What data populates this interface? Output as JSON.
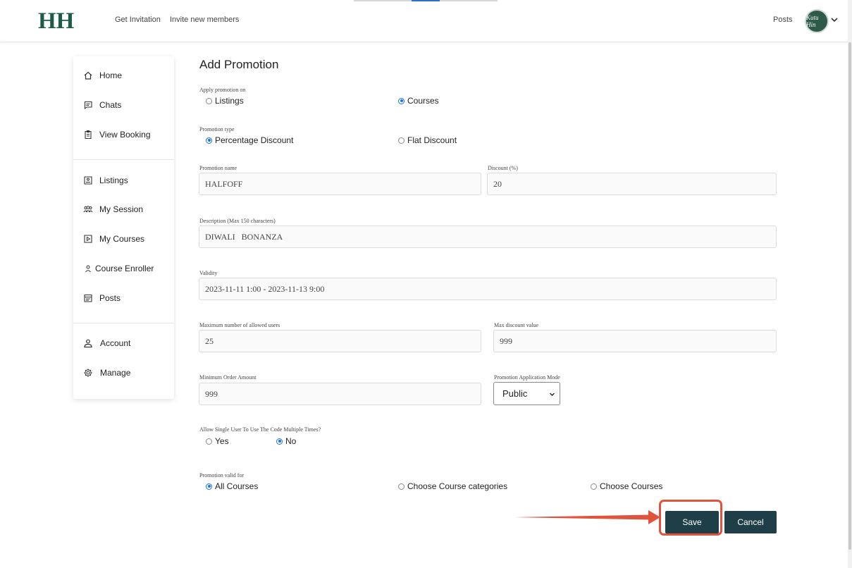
{
  "header": {
    "logo": "HH",
    "nav": [
      "Get Invitation",
      "Invite new members"
    ],
    "posts_link": "Posts",
    "avatar_text": "Kutu Hin"
  },
  "sidebar": {
    "group1": [
      "Home",
      "Chats",
      "View Booking"
    ],
    "group2": [
      "Listings",
      "My Session",
      "My Courses",
      "Course Enroller",
      "Posts"
    ],
    "group3": [
      "Account",
      "Manage"
    ]
  },
  "form": {
    "title": "Add Promotion",
    "apply_on": {
      "label": "Apply promotion on",
      "options": [
        "Listings",
        "Courses"
      ],
      "selected": "Courses"
    },
    "promotion_type": {
      "label": "Promotion type",
      "options": [
        "Percentage Discount",
        "Flat Discount"
      ],
      "selected": "Percentage Discount"
    },
    "promotion_name": {
      "label": "Promotion name",
      "value": "HALFOFF"
    },
    "discount": {
      "label": "Discount (%)",
      "value": "20"
    },
    "description": {
      "label": "Description (Max 150 characters)",
      "value": "DIWALI   BONANZA"
    },
    "validity": {
      "label": "Validity",
      "value": "2023-11-11 1:00 - 2023-11-13 9:00"
    },
    "max_users": {
      "label": "Maximum number of allowed users",
      "value": "25"
    },
    "max_discount": {
      "label": "Max discount value",
      "value": "999"
    },
    "min_order": {
      "label": "Minimum Order Amount",
      "value": "999"
    },
    "application_mode": {
      "label": "Promotion Application Mode",
      "value": "Public"
    },
    "multi_use": {
      "label": "Allow Single User To Use The Code Multiple Times?",
      "options": [
        "Yes",
        "No"
      ],
      "selected": "No"
    },
    "valid_for": {
      "label": "Promotion valid for",
      "options": [
        "All Courses",
        "Choose Course categories",
        "Choose Courses"
      ],
      "selected": "All Courses"
    },
    "save_label": "Save",
    "cancel_label": "Cancel"
  },
  "colors": {
    "brand": "#1f5c48",
    "button": "#1e3f47",
    "annotation": "#e0533d",
    "radio_selected": "#1a73e8"
  }
}
